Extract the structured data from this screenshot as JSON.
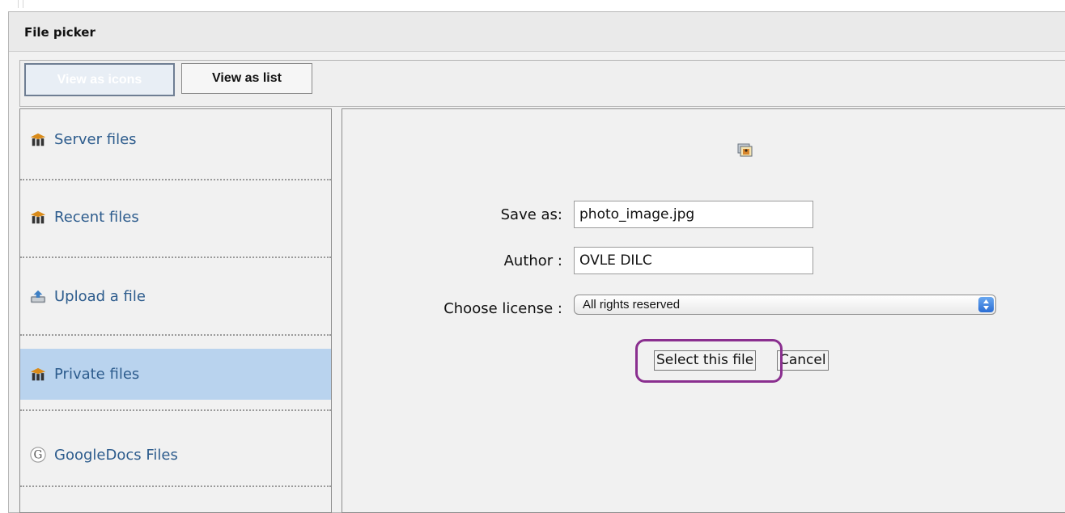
{
  "window": {
    "title": "File picker"
  },
  "view_toggle": {
    "icons_label": "View as icons",
    "list_label": "View as list"
  },
  "sidebar": {
    "items": [
      {
        "label": "Server files",
        "icon": "moodle-icon",
        "selected": false
      },
      {
        "label": "Recent files",
        "icon": "moodle-icon",
        "selected": false
      },
      {
        "label": "Upload a file",
        "icon": "upload-icon",
        "selected": false
      },
      {
        "label": "Private files",
        "icon": "moodle-icon",
        "selected": true
      },
      {
        "label": "GoogleDocs Files",
        "icon": "google-icon",
        "selected": false
      }
    ]
  },
  "form": {
    "thumbnail_icon": "image-file-icon",
    "save_as_label": "Save as:",
    "save_as_value": "photo_image.jpg",
    "author_label": "Author :",
    "author_value": "OVLE DILC",
    "license_label": "Choose license :",
    "license_value": "All rights reserved",
    "select_button": "Select this file",
    "cancel_button": "Cancel"
  },
  "colors": {
    "selected_row": "#b9d3ee",
    "link_text": "#2d5c8d",
    "highlight_ring": "#8a2f8f"
  }
}
